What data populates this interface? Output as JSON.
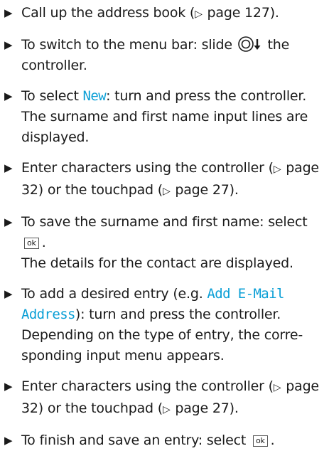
{
  "bullet_glyph": "▶",
  "ref_glyph": "▷",
  "accent_color": "#0a9fd6",
  "steps": [
    {
      "a": "Call up the address book (",
      "page": "page 127",
      "b": ")."
    },
    {
      "a": "To switch to the menu bar: slide",
      "icon": "controller-slide-down-icon",
      "b": "the controller."
    },
    {
      "a": "To select ",
      "key": "New",
      "b": ": turn and press the controller. The surname and first name input lines are displayed."
    },
    {
      "a": "Enter characters using the controller (",
      "page1": "page 32",
      "b": ") or the touchpad (",
      "page2": "page 27",
      "c": ")."
    },
    {
      "a": "To save the surname and first name: select",
      "ok": "ok",
      "b": ".",
      "result": "The details for the contact are displayed."
    },
    {
      "a": "To add a desired entry (e.g. ",
      "key": "Add E-Mail Address",
      "b": "): turn and press the controller. Depending on the type of entry, the corre-sponding input menu appears."
    },
    {
      "a": "Enter characters using the controller (",
      "page1": "page 32",
      "b": ") or the touchpad (",
      "page2": "page 27",
      "c": ")."
    },
    {
      "a": "To finish and save an entry: select",
      "ok": "ok",
      "b": "."
    }
  ]
}
